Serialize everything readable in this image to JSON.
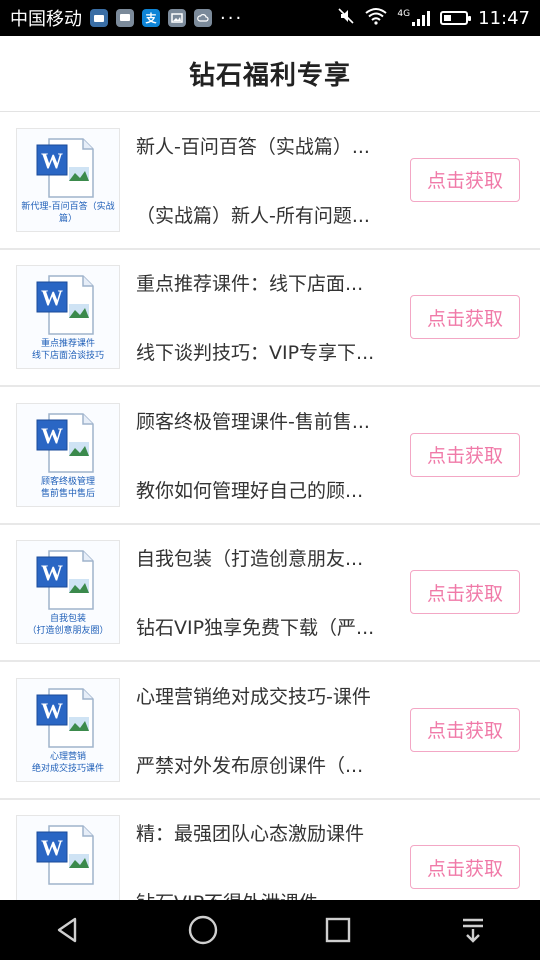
{
  "statusbar": {
    "carrier": "中国移动",
    "time": "11:47",
    "network": "4G",
    "battery_level": 0.35,
    "notification_icons": [
      "wallet-icon",
      "message-icon",
      "alipay-icon",
      "gallery-icon",
      "cloud-icon"
    ],
    "overflow": "···"
  },
  "header": {
    "title": "钻石福利专享"
  },
  "items": [
    {
      "thumb": "新代理-百问百答（实战篇）",
      "line1": "新人-百问百答（实战篇）...",
      "line2": "（实战篇）新人-所有问题...",
      "button": "点击获取"
    },
    {
      "thumb": "重点推荐课件\n线下店面洽谈技巧",
      "line1": "重点推荐课件：线下店面...",
      "line2": "线下谈判技巧：VIP专享下...",
      "button": "点击获取"
    },
    {
      "thumb": "顾客终极管理\n售前售中售后",
      "line1": "顾客终极管理课件-售前售...",
      "line2": "教你如何管理好自己的顾...",
      "button": "点击获取"
    },
    {
      "thumb": "自我包装\n（打造创意朋友圈）",
      "line1": "自我包装（打造创意朋友...",
      "line2": "钻石VIP独享免费下载（严...",
      "button": "点击获取"
    },
    {
      "thumb": "心理营销\n绝对成交技巧课件",
      "line1": "心理营销绝对成交技巧-课件",
      "line2": "严禁对外发布原创课件（...",
      "button": "点击获取"
    },
    {
      "thumb": "",
      "line1": "精：最强团队心态激励课件",
      "line2": "钻石VIP不得外泄课件",
      "button": "点击获取"
    }
  ],
  "colors": {
    "accent": "#f07aa8",
    "doc_blue": "#1f5fb8"
  }
}
